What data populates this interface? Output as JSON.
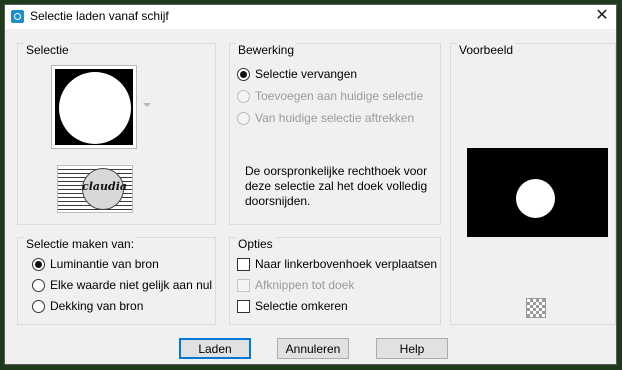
{
  "window": {
    "title": "Selectie laden vanaf schijf",
    "close_icon": "close-x-icon"
  },
  "groups": {
    "selectie": {
      "label": "Selectie"
    },
    "bewerking": {
      "label": "Bewerking",
      "options": [
        {
          "label": "Selectie vervangen",
          "checked": true,
          "enabled": true
        },
        {
          "label": "Toevoegen aan huidige selectie",
          "checked": false,
          "enabled": false
        },
        {
          "label": "Van huidige selectie aftrekken",
          "checked": false,
          "enabled": false
        }
      ],
      "info": "De oorspronkelijke rechthoek voor deze selectie zal het doek volledig doorsnijden."
    },
    "voorbeeld": {
      "label": "Voorbeeld"
    },
    "maken_van": {
      "label": "Selectie maken van:",
      "options": [
        {
          "label": "Luminantie van bron",
          "checked": true
        },
        {
          "label": "Elke waarde niet gelijk aan nul",
          "checked": false
        },
        {
          "label": "Dekking van bron",
          "checked": false
        }
      ]
    },
    "opties": {
      "label": "Opties",
      "checks": [
        {
          "label": "Naar linkerbovenhoek verplaatsen",
          "checked": false,
          "enabled": true
        },
        {
          "label": "Afknippen tot doek",
          "checked": false,
          "enabled": false
        },
        {
          "label": "Selectie omkeren",
          "checked": false,
          "enabled": true
        }
      ]
    }
  },
  "watermark_text": "claudia",
  "buttons": {
    "ok": "Laden",
    "cancel": "Annuleren",
    "help": "Help"
  },
  "colors": {
    "frame": "#1f3a1c",
    "default_button_border": "#0078d7"
  }
}
